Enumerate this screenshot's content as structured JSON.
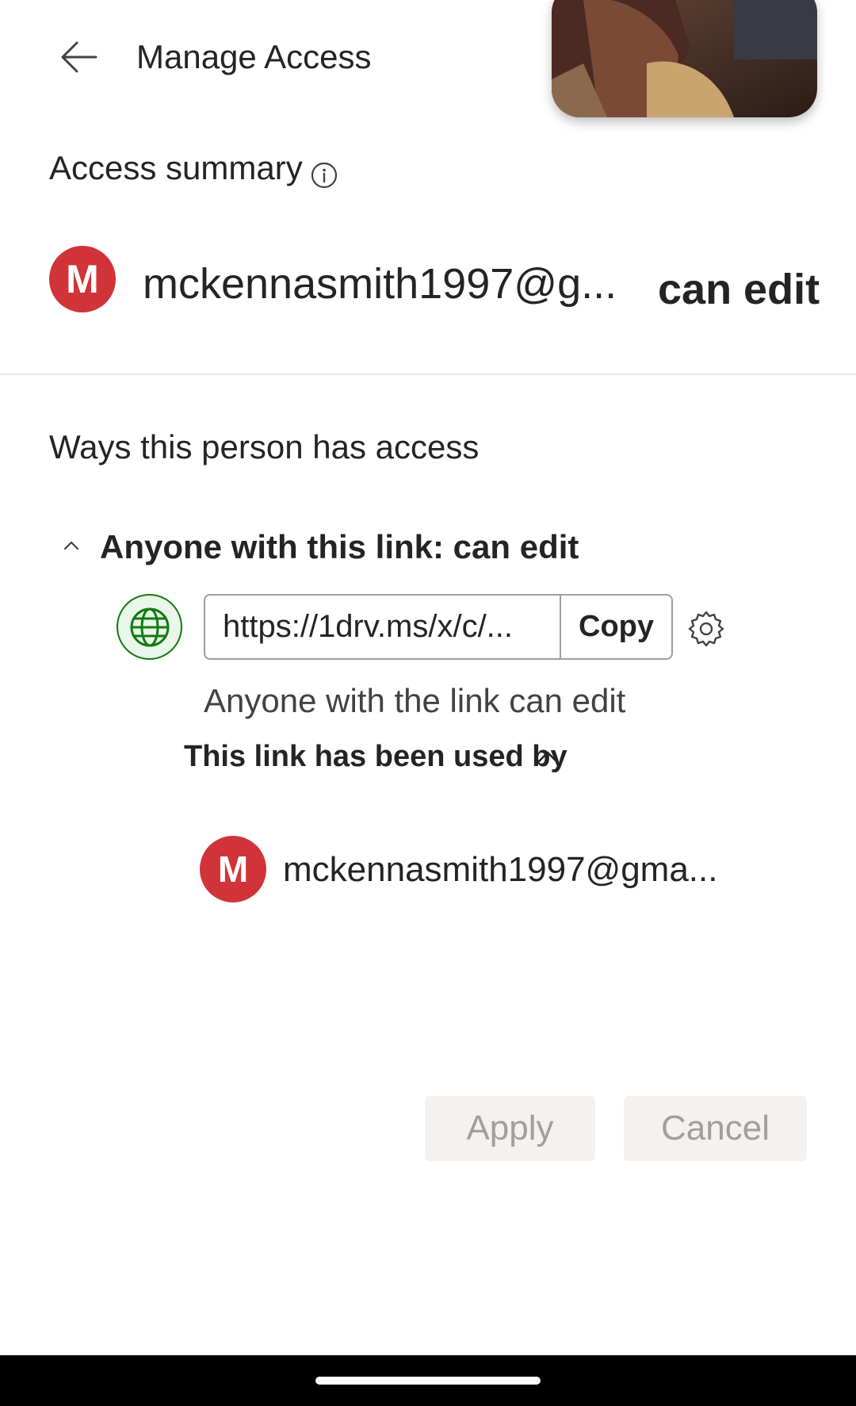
{
  "header": {
    "title": "Manage Access"
  },
  "access_summary": {
    "heading": "Access summary",
    "person": {
      "avatar_initial": "M",
      "email": "mckennasmith1997@g...",
      "permission": "can edit"
    }
  },
  "ways": {
    "heading": "Ways this person has access",
    "link_section": {
      "title": "Anyone with this link: can edit",
      "url": "https://1drv.ms/x/c/...",
      "copy_label": "Copy",
      "description": "Anyone with the link can edit",
      "used_by_label": "This link has been used by",
      "used_by": [
        {
          "avatar_initial": "M",
          "email": "mckennasmith1997@gma..."
        }
      ]
    }
  },
  "footer": {
    "apply_label": "Apply",
    "cancel_label": "Cancel"
  },
  "colors": {
    "avatar": "#d13438",
    "globe": "#107c10",
    "disabled_text": "#a19f9d",
    "button_bg": "#f3f2f1"
  }
}
